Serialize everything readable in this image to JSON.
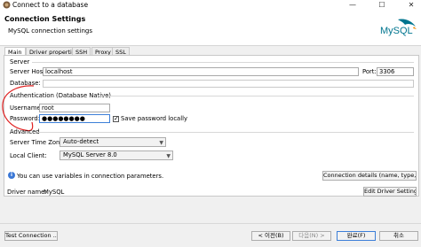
{
  "window": {
    "title": "Connect to a database",
    "minimize_glyph": "—",
    "maximize_glyph": "☐",
    "close_glyph": "✕"
  },
  "header": {
    "title": "Connection Settings",
    "subtitle": "MySQL connection settings",
    "logo_text": "MySQL"
  },
  "tabs": [
    {
      "label": "Main",
      "active": true
    },
    {
      "label": "Driver properties",
      "active": false
    },
    {
      "label": "SSH",
      "active": false
    },
    {
      "label": "Proxy",
      "active": false
    },
    {
      "label": "SSL",
      "active": false
    }
  ],
  "server": {
    "group_label": "Server",
    "host_label": "Server Host:",
    "host_value": "localhost",
    "port_label": "Port:",
    "port_value": "3306",
    "database_label": "Database:",
    "database_value": ""
  },
  "auth": {
    "group_label": "Authentication (Database Native)",
    "username_label": "Username:",
    "username_value": "root",
    "password_label": "Password:",
    "password_value": "●●●●●●●●",
    "save_password_label": "Save password locally",
    "save_password_checked": true
  },
  "advanced": {
    "group_label": "Advanced",
    "timezone_label": "Server Time Zone:",
    "timezone_value": "Auto-detect",
    "client_label": "Local Client:",
    "client_value": "MySQL Server 8.0"
  },
  "info": {
    "text": "You can use variables in connection parameters.",
    "details_button": "Connection details (name, type, ..."
  },
  "driver": {
    "label": "Driver name:",
    "value": "MySQL",
    "edit_button": "Edit Driver Settings"
  },
  "footer": {
    "test_button": "Test Connection ...",
    "back_button": "< 이전(B)",
    "next_button": "다음(N) >",
    "finish_button": "완료(F)",
    "cancel_button": "취소"
  },
  "colors": {
    "accent": "#3c7fd8",
    "annotation": "#e02020",
    "logo_blue": "#00758f",
    "logo_orange": "#f29111"
  },
  "icons": {
    "app": "dbeaver-icon",
    "info": "info-icon",
    "dropdown": "chevron-down-icon"
  }
}
